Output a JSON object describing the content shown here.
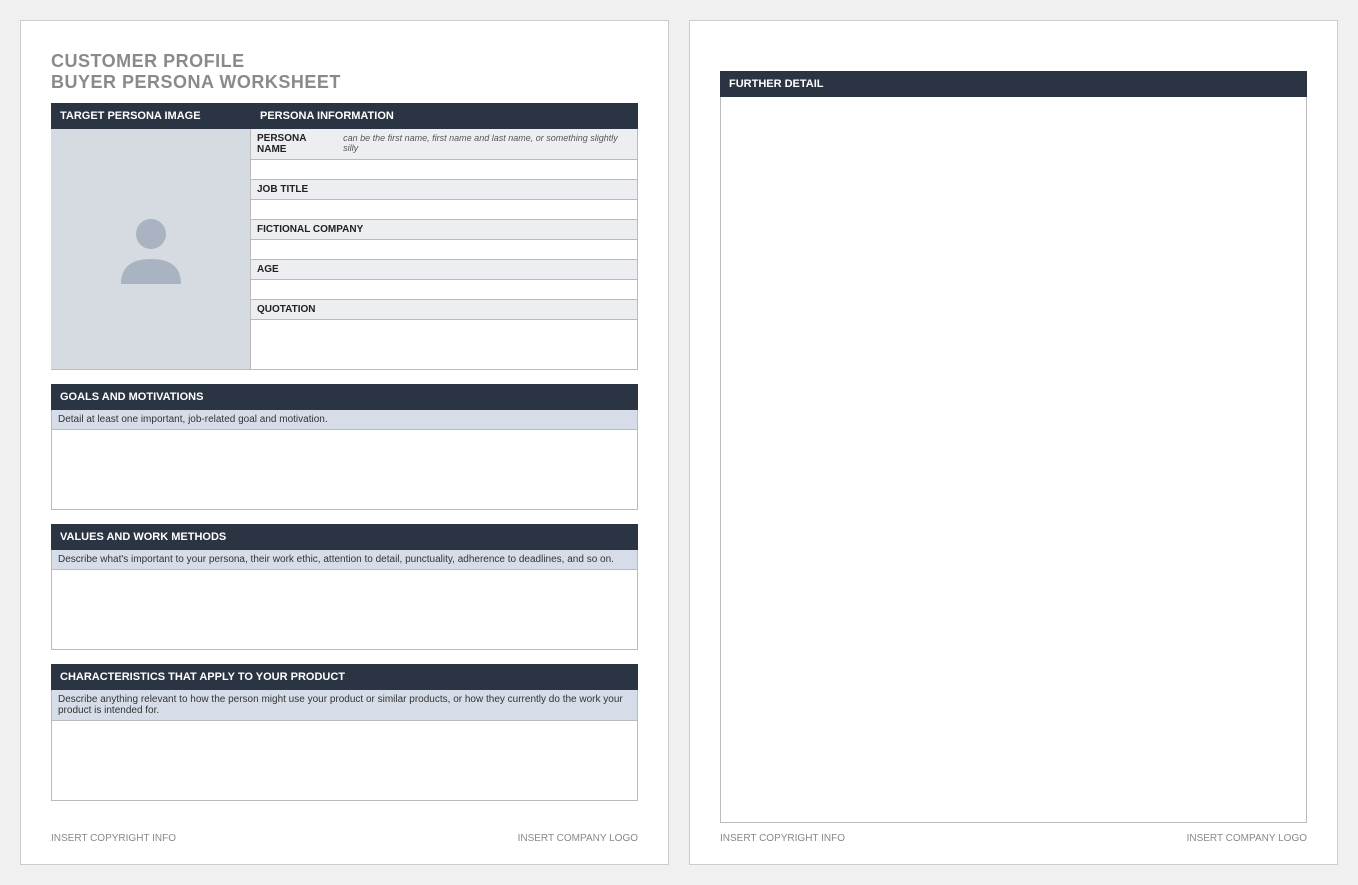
{
  "title": {
    "line1": "CUSTOMER PROFILE",
    "line2": "BUYER PERSONA WORKSHEET"
  },
  "headers": {
    "target_image": "TARGET PERSONA IMAGE",
    "persona_info": "PERSONA INFORMATION",
    "goals": "GOALS AND MOTIVATIONS",
    "values": "VALUES AND WORK METHODS",
    "characteristics": "CHARACTERISTICS THAT APPLY TO YOUR PRODUCT",
    "further_detail": "FURTHER DETAIL"
  },
  "fields": {
    "persona_name": {
      "label": "PERSONA NAME",
      "hint": "can be the first name, first name and last name, or something slightly silly"
    },
    "job_title": {
      "label": "JOB TITLE"
    },
    "fictional_company": {
      "label": "FICTIONAL COMPANY"
    },
    "age": {
      "label": "AGE"
    },
    "quotation": {
      "label": "QUOTATION"
    }
  },
  "hints": {
    "goals": "Detail at least one important, job-related goal and motivation.",
    "values": "Describe what's important to your persona, their work ethic, attention to detail, punctuality, adherence to deadlines, and so on.",
    "characteristics": "Describe anything relevant to how the person might use your product or similar products, or how they currently do the work your product is intended for."
  },
  "footer": {
    "copyright": "INSERT COPYRIGHT INFO",
    "logo": "INSERT COMPANY LOGO"
  }
}
